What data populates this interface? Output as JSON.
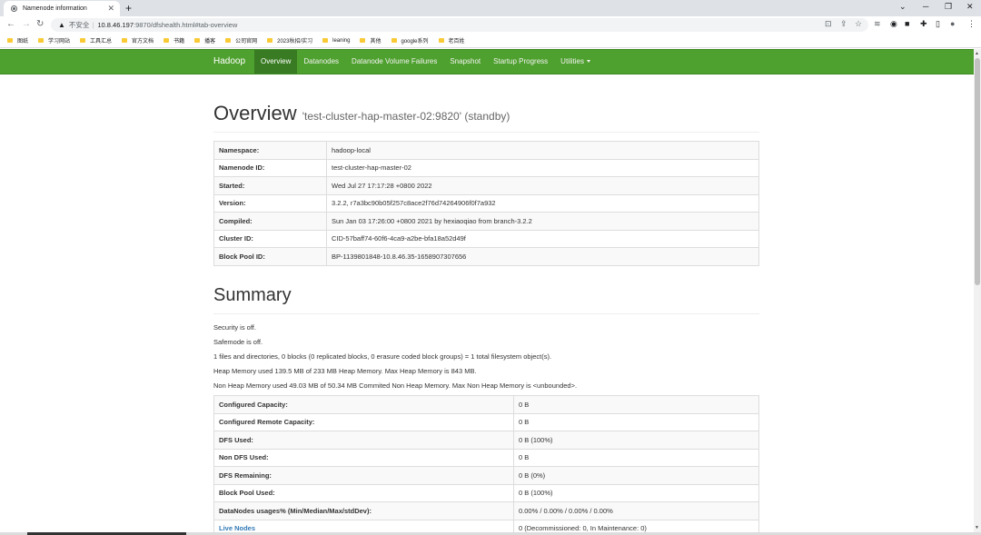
{
  "browser": {
    "tab_title": "Namenode information",
    "new_tab": "+",
    "security_warning": "不安全",
    "url_host": "10.8.46.197",
    "url_path": ":9870/dfshealth.html#tab-overview",
    "bookmarks": [
      "图纸",
      "学习网站",
      "工具汇总",
      "官方文档",
      "书籍",
      "播客",
      "公司官网",
      "2023秋招/实习",
      "leaning",
      "其他",
      "google系列",
      "老百姓"
    ]
  },
  "navbar": {
    "brand": "Hadoop",
    "items": [
      "Overview",
      "Datanodes",
      "Datanode Volume Failures",
      "Snapshot",
      "Startup Progress",
      "Utilities"
    ],
    "color": "#4fa12f"
  },
  "overview": {
    "title": "Overview",
    "subtitle": "'test-cluster-hap-master-02:9820' (standby)",
    "rows": [
      {
        "key": "Namespace:",
        "value": "hadoop-local"
      },
      {
        "key": "Namenode ID:",
        "value": "test-cluster-hap-master-02"
      },
      {
        "key": "Started:",
        "value": "Wed Jul 27 17:17:28 +0800 2022"
      },
      {
        "key": "Version:",
        "value": "3.2.2, r7a3bc90b05f257c8ace2f76d74264906f0f7a932"
      },
      {
        "key": "Compiled:",
        "value": "Sun Jan 03 17:26:00 +0800 2021 by hexiaoqiao from branch-3.2.2"
      },
      {
        "key": "Cluster ID:",
        "value": "CID-57baff74-60f6-4ca9-a2be-bfa18a52d49f"
      },
      {
        "key": "Block Pool ID:",
        "value": "BP-1139801848-10.8.46.35-1658907307656"
      }
    ]
  },
  "summary": {
    "title": "Summary",
    "lines": [
      "Security is off.",
      "Safemode is off.",
      "1 files and directories, 0 blocks (0 replicated blocks, 0 erasure coded block groups) = 1 total filesystem object(s).",
      "Heap Memory used 139.5 MB of 233 MB Heap Memory. Max Heap Memory is 843 MB.",
      "Non Heap Memory used 49.03 MB of 50.34 MB Commited Non Heap Memory. Max Non Heap Memory is <unbounded>."
    ],
    "rows": [
      {
        "key": "Configured Capacity:",
        "value": "0 B"
      },
      {
        "key": "Configured Remote Capacity:",
        "value": "0 B"
      },
      {
        "key": "DFS Used:",
        "value": "0 B (100%)"
      },
      {
        "key": "Non DFS Used:",
        "value": "0 B"
      },
      {
        "key": "DFS Remaining:",
        "value": "0 B (0%)"
      },
      {
        "key": "Block Pool Used:",
        "value": "0 B (100%)"
      },
      {
        "key": "DataNodes usages% (Min/Median/Max/stdDev):",
        "value": "0.00% / 0.00% / 0.00% / 0.00%"
      },
      {
        "key": "Live Nodes",
        "value": "0 (Decommissioned: 0, In Maintenance: 0)",
        "link": true
      }
    ]
  }
}
